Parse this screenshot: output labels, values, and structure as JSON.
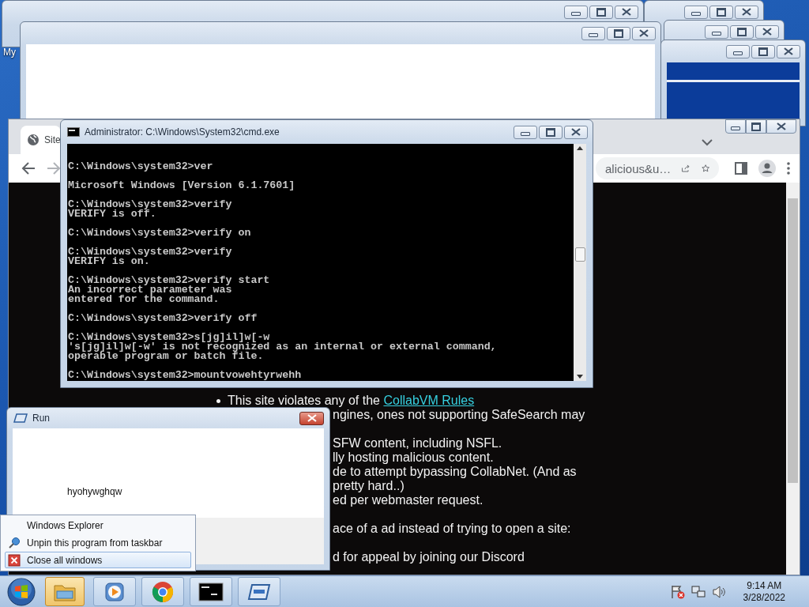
{
  "desktop": {
    "icon_label": "My"
  },
  "browser": {
    "tab_title": "Site",
    "address": "alicious&u…",
    "page_groups": [
      [
        {
          "kind": "bullet",
          "text": "This site violates any of the ",
          "link": "CollabVM Rules"
        },
        {
          "kind": "line",
          "text": "ngines, ones not supporting SafeSearch may"
        }
      ],
      [
        {
          "kind": "line",
          "text": "SFW content, including NSFL."
        },
        {
          "kind": "line",
          "text": "lly hosting malicious content."
        },
        {
          "kind": "line",
          "text": "de to attempt bypassing CollabNet. (And as"
        },
        {
          "kind": "line",
          "text": "pretty hard..)"
        },
        {
          "kind": "line",
          "text": "ed per webmaster request."
        }
      ],
      [
        {
          "kind": "line",
          "text": "ace of a ad instead of trying to open a site:"
        }
      ],
      [
        {
          "kind": "line",
          "text": "d for appeal by joining our Discord"
        }
      ]
    ]
  },
  "cmd": {
    "title": "Administrator: C:\\Windows\\System32\\cmd.exe",
    "blocks": [
      [
        "C:\\Windows\\system32>ver"
      ],
      [
        "Microsoft Windows [Version 6.1.7601]"
      ],
      [
        "C:\\Windows\\system32>verify",
        "VERIFY is off."
      ],
      [
        "C:\\Windows\\system32>verify on"
      ],
      [
        "C:\\Windows\\system32>verify",
        "VERIFY is on."
      ],
      [
        "C:\\Windows\\system32>verify start",
        "An incorrect parameter was",
        "entered for the command."
      ],
      [
        "C:\\Windows\\system32>verify off"
      ],
      [
        "C:\\Windows\\system32>s[jg]il]w[-w",
        "'s[jg]il]w[-w' is not recognized as an internal or external command,",
        "operable program or batch file."
      ],
      [
        "C:\\Windows\\system32>mountvowehtyrwehh"
      ]
    ]
  },
  "run_dialog": {
    "title": "Run",
    "text": "hyohywghqw"
  },
  "jump_list": [
    {
      "kind": "plain",
      "label": "Windows Explorer",
      "selected": false
    },
    {
      "kind": "pin",
      "label": "Unpin this program from taskbar",
      "selected": false
    },
    {
      "kind": "close",
      "label": "Close all windows",
      "selected": true
    }
  ],
  "taskbar": {
    "buttons": [
      {
        "kind": "explorer",
        "selected": true
      },
      {
        "kind": "media",
        "selected": false
      },
      {
        "kind": "chrome",
        "selected": false
      },
      {
        "kind": "cmd",
        "selected": false
      },
      {
        "kind": "run",
        "selected": false
      }
    ],
    "clock": {
      "time": "9:14 AM",
      "date": "3/28/2022"
    }
  }
}
